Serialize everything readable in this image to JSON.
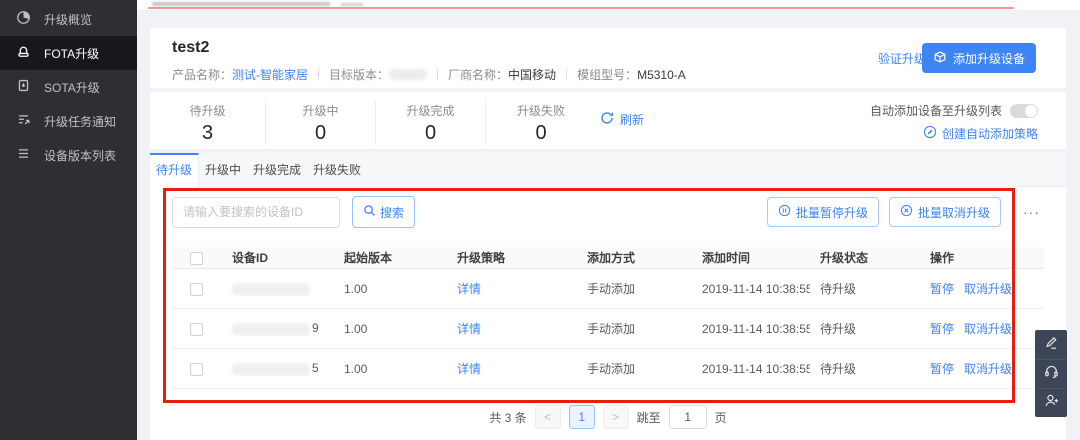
{
  "colors": {
    "accent": "#3d84f5",
    "sidebar_bg": "#2d2f33",
    "sidebar_active_bg": "#16181b",
    "annotation_red": "#ea1c0d",
    "page_bg": "#f0f2f5"
  },
  "sidebar": {
    "items": [
      {
        "label": "升级概览",
        "icon": "pie-chart-icon",
        "active": false
      },
      {
        "label": "FOTA升级",
        "icon": "fota-device-icon",
        "active": true
      },
      {
        "label": "SOTA升级",
        "icon": "sota-device-icon",
        "active": false
      },
      {
        "label": "升级任务通知",
        "icon": "task-notify-icon",
        "active": false
      },
      {
        "label": "设备版本列表",
        "icon": "version-list-icon",
        "active": false
      }
    ]
  },
  "header": {
    "title": "test2",
    "product_label": "产品名称：",
    "product_value": "测试-智能家居",
    "target_label": "目标版本：",
    "target_masked": true,
    "vendor_label": "厂商名称：",
    "vendor_value": "中国移动",
    "module_label": "模组型号：",
    "module_value": "M5310-A",
    "verify_button": "验证升级",
    "add_device_button": "添加升级设备"
  },
  "stats": {
    "items": [
      {
        "label": "待升级",
        "value": "3"
      },
      {
        "label": "升级中",
        "value": "0"
      },
      {
        "label": "升级完成",
        "value": "0"
      },
      {
        "label": "升级失败",
        "value": "0"
      }
    ],
    "refresh_label": "刷新",
    "auto_add_label": "自动添加设备至升级列表",
    "auto_add_on": false,
    "create_policy_label": "创建自动添加策略"
  },
  "tabs": [
    {
      "label": "待升级",
      "active": true
    },
    {
      "label": "升级中",
      "active": false
    },
    {
      "label": "升级完成",
      "active": false
    },
    {
      "label": "升级失败",
      "active": false
    }
  ],
  "toolbar": {
    "search_placeholder": "请输入要搜索的设备ID",
    "search_label": "搜索",
    "batch_pause_label": "批量暂停升级",
    "batch_cancel_label": "批量取消升级",
    "more_label": "···"
  },
  "table": {
    "columns": [
      "设备ID",
      "起始版本",
      "升级策略",
      "添加方式",
      "添加时间",
      "升级状态",
      "操作"
    ],
    "rows": [
      {
        "device_id_masked": true,
        "device_id_suffix": "",
        "start_version": "1.00",
        "strategy_link": "详情",
        "add_mode": "手动添加",
        "add_time": "2019-11-14 10:38:55",
        "status": "待升级",
        "action_pause": "暂停",
        "action_cancel": "取消升级"
      },
      {
        "device_id_masked": true,
        "device_id_suffix": "9",
        "start_version": "1.00",
        "strategy_link": "详情",
        "add_mode": "手动添加",
        "add_time": "2019-11-14 10:38:55",
        "status": "待升级",
        "action_pause": "暂停",
        "action_cancel": "取消升级"
      },
      {
        "device_id_masked": true,
        "device_id_suffix": "5",
        "start_version": "1.00",
        "strategy_link": "详情",
        "add_mode": "手动添加",
        "add_time": "2019-11-14 10:38:55",
        "status": "待升级",
        "action_pause": "暂停",
        "action_cancel": "取消升级"
      }
    ]
  },
  "pagination": {
    "total": "共 3 条",
    "prev": "<",
    "page": "1",
    "next": ">",
    "jump_prefix": "跳至",
    "jump_value": "1",
    "jump_suffix": "页"
  }
}
